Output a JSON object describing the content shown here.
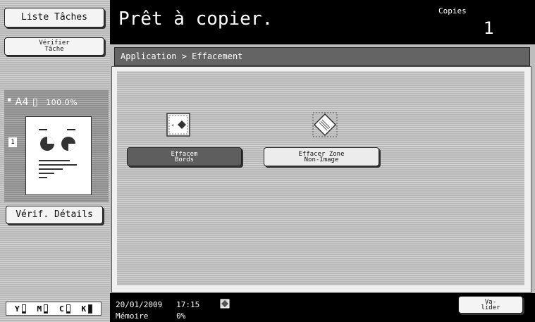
{
  "left": {
    "liste_taches": "Liste Tâches",
    "verifier_tache": "Vérifier\nTâche",
    "status_paper": "A4",
    "status_zoom": "100.0%",
    "copy_count_icon": "1",
    "verif_details": "Vérif. Détails",
    "toner": [
      {
        "label": "Y",
        "level": 0.15
      },
      {
        "label": "M",
        "level": 0.15
      },
      {
        "label": "C",
        "level": 0.15
      },
      {
        "label": "K",
        "level": 0.95
      }
    ]
  },
  "header": {
    "title": "Prêt à copier.",
    "copies_label": "Copies",
    "copies_value": "1"
  },
  "breadcrumb": "Application > Effacement",
  "main": {
    "buttons": [
      {
        "label": "Effacem\nBords",
        "icon": "edge-erase-icon"
      },
      {
        "label": "Effacer Zone\nNon-Image",
        "icon": "non-image-erase-icon"
      }
    ]
  },
  "footer": {
    "date": "20/01/2009",
    "time": "17:15",
    "memory_label": "Mémoire",
    "memory_value": "0%",
    "valider": "Va-\nlider"
  },
  "colors": {
    "header_bg": "#000000",
    "selected_button": "#5e5e5e",
    "panel_bg": "#bdbdbd"
  }
}
